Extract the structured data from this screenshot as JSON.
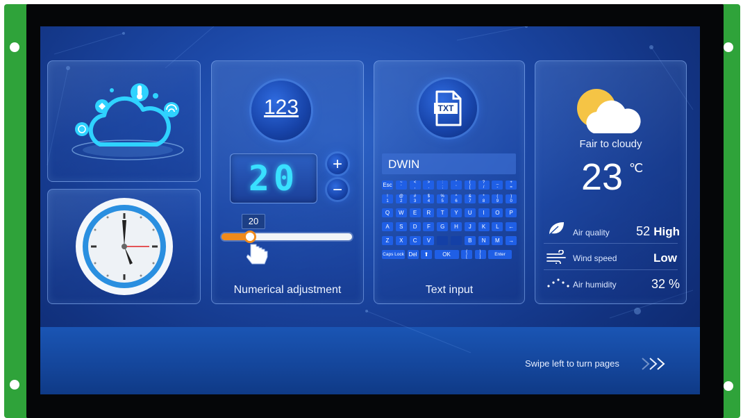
{
  "numeric": {
    "button_label": "123",
    "display_value": "20",
    "slider_value": "20",
    "slider_fraction": 0.2,
    "title": "Numerical adjustment",
    "plus": "+",
    "minus": "−"
  },
  "text_input": {
    "file_label": "TXT",
    "field_value": "DWIN",
    "title": "Text input",
    "keyboard_rows": [
      [
        "Esc",
        "~ `",
        "< ,",
        "> .",
        ": ;",
        "\" '",
        "{ [",
        "? /",
        "_ -",
        "+ ="
      ],
      [
        "! 1",
        "@ 2",
        "# 3",
        "$ 4",
        "% 5",
        "^ 6",
        "& 7",
        "* 8",
        "( 9",
        ") 0"
      ],
      [
        "Q",
        "W",
        "E",
        "R",
        "T",
        "Y",
        "U",
        "I",
        "O",
        "P"
      ],
      [
        "A",
        "S",
        "D",
        "F",
        "G",
        "H",
        "J",
        "K",
        "L",
        "←"
      ],
      [
        "Z",
        "X",
        "C",
        "V",
        "",
        "",
        "B",
        "N",
        "M",
        "→"
      ]
    ],
    "bottom_row": [
      "Caps Lock",
      "Del",
      "⬆",
      "OK",
      "{ [",
      "} ]",
      "Enter"
    ]
  },
  "weather": {
    "condition": "Fair to cloudy",
    "temperature": "23",
    "unit": "℃",
    "air_quality_label": "Air quality",
    "air_quality_value": "52",
    "air_quality_level": "High",
    "wind_label": "Wind speed",
    "wind_value": "Low",
    "humidity_label": "Air humidity",
    "humidity_value": "32 %"
  },
  "footer": {
    "swipe_hint": "Swipe left to turn pages",
    "arrows": ">>"
  },
  "colors": {
    "accent": "#2fd3ff",
    "key_blue": "#1f5fe6",
    "slider_orange": "#f08a1c",
    "pcb_green": "#2fa33a"
  }
}
